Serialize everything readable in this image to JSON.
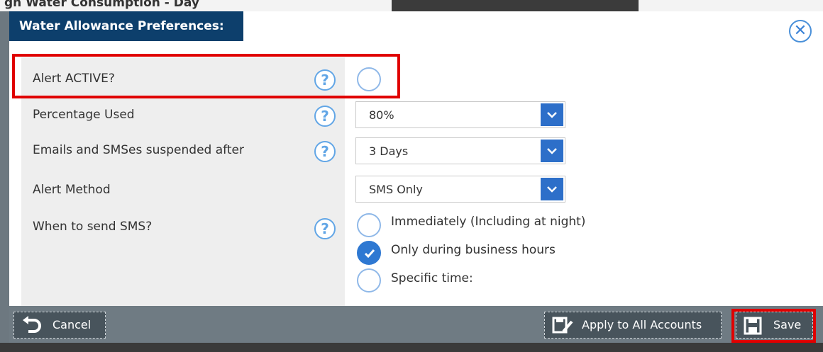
{
  "background": {
    "title": "gh Water Consumption - Day"
  },
  "dialog": {
    "title": "Water Allowance Preferences:",
    "rows": [
      {
        "label": "Alert ACTIVE?"
      },
      {
        "label": "Percentage Used",
        "value": "80%"
      },
      {
        "label": "Emails and SMSes suspended after",
        "value": "3 Days"
      },
      {
        "label": "Alert Method",
        "value": "SMS Only"
      },
      {
        "label": "When to send SMS?"
      }
    ],
    "sms_options": [
      {
        "label": "Immediately (Including at night)",
        "checked": false
      },
      {
        "label": "Only during business hours",
        "checked": true
      },
      {
        "label": "Specific time:",
        "checked": false
      }
    ],
    "alert_active": false
  },
  "footer": {
    "cancel_label": "Cancel",
    "apply_label": "Apply to All Accounts",
    "save_label": "Save"
  },
  "colors": {
    "header": "#0d3f6c",
    "accent": "#2e78d2",
    "highlight": "#e00000"
  },
  "icons": [
    "close-icon",
    "help-icon",
    "chevron-down-icon",
    "check-icon",
    "undo-icon",
    "apply-all-icon",
    "save-icon"
  ]
}
